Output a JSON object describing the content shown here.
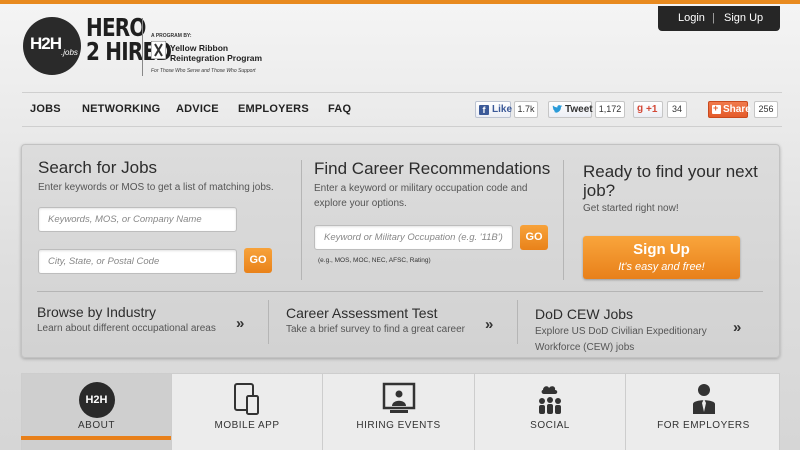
{
  "header": {
    "logo_h2h": "H2H",
    "logo_jobs": ".jobs",
    "hero_line1": "HERO",
    "hero_line2": "2 HIRED",
    "program_by": "A PROGRAM BY:",
    "yrrp_line1": "Yellow Ribbon",
    "yrrp_line2": "Reintegration Program",
    "yrrp_tagline": "For Those Who Serve and Those Who Support",
    "login": "Login",
    "separator": "|",
    "signup": "Sign Up"
  },
  "nav": {
    "items": [
      "JOBS",
      "NETWORKING",
      "ADVICE",
      "EMPLOYERS",
      "FAQ"
    ]
  },
  "social": {
    "facebook_label": "Like",
    "facebook_count": "1.7k",
    "twitter_label": "Tweet",
    "twitter_count": "1,172",
    "google_label": "+1",
    "google_count": "34",
    "share_label": "Share",
    "share_count": "256"
  },
  "search": {
    "title": "Search for Jobs",
    "desc": "Enter keywords or MOS to get a list of matching jobs.",
    "keywords_placeholder": "Keywords, MOS, or Company Name",
    "location_placeholder": "City, State, or Postal Code",
    "go_label": "GO"
  },
  "career": {
    "title": "Find Career Recommendations",
    "desc_line1": "Enter a keyword or military occupation code and",
    "desc_line2": "explore your options.",
    "placeholder": "Keyword or Military Occupation (e.g. '11B')",
    "go_label": "GO",
    "hint": "(e.g., MOS, MOC, NEC, AFSC, Rating)"
  },
  "ready": {
    "title_line1": "Ready to find your next",
    "title_line2": "job?",
    "subtitle": "Get started right now!",
    "button_line1": "Sign Up",
    "button_line2": "It's easy and free!"
  },
  "links": [
    {
      "title": "Browse by Industry",
      "desc_line1": "Learn about different occupational areas",
      "desc_line2": ""
    },
    {
      "title": "Career Assessment Test",
      "desc_line1": "Take a brief survey to find a great career",
      "desc_line2": ""
    },
    {
      "title": "DoD CEW Jobs",
      "desc_line1": "Explore US DoD Civilian Expeditionary",
      "desc_line2": "Workforce (CEW) jobs"
    }
  ],
  "chevron": "»",
  "tabs": [
    {
      "label": "ABOUT",
      "icon": "h2h-logo-icon",
      "icon_text": "H2H"
    },
    {
      "label": "MOBILE APP",
      "icon": "mobile-devices-icon"
    },
    {
      "label": "HIRING EVENTS",
      "icon": "presentation-screen-icon"
    },
    {
      "label": "SOCIAL",
      "icon": "social-network-icon"
    },
    {
      "label": "FOR EMPLOYERS",
      "icon": "employer-person-icon"
    }
  ],
  "colors": {
    "accent_orange": "#e8801a",
    "header_dark": "#262626",
    "facebook_blue": "#3b5998",
    "twitter_blue": "#2a9bd8",
    "google_red": "#d34836",
    "share_orange": "#e45b2a"
  }
}
